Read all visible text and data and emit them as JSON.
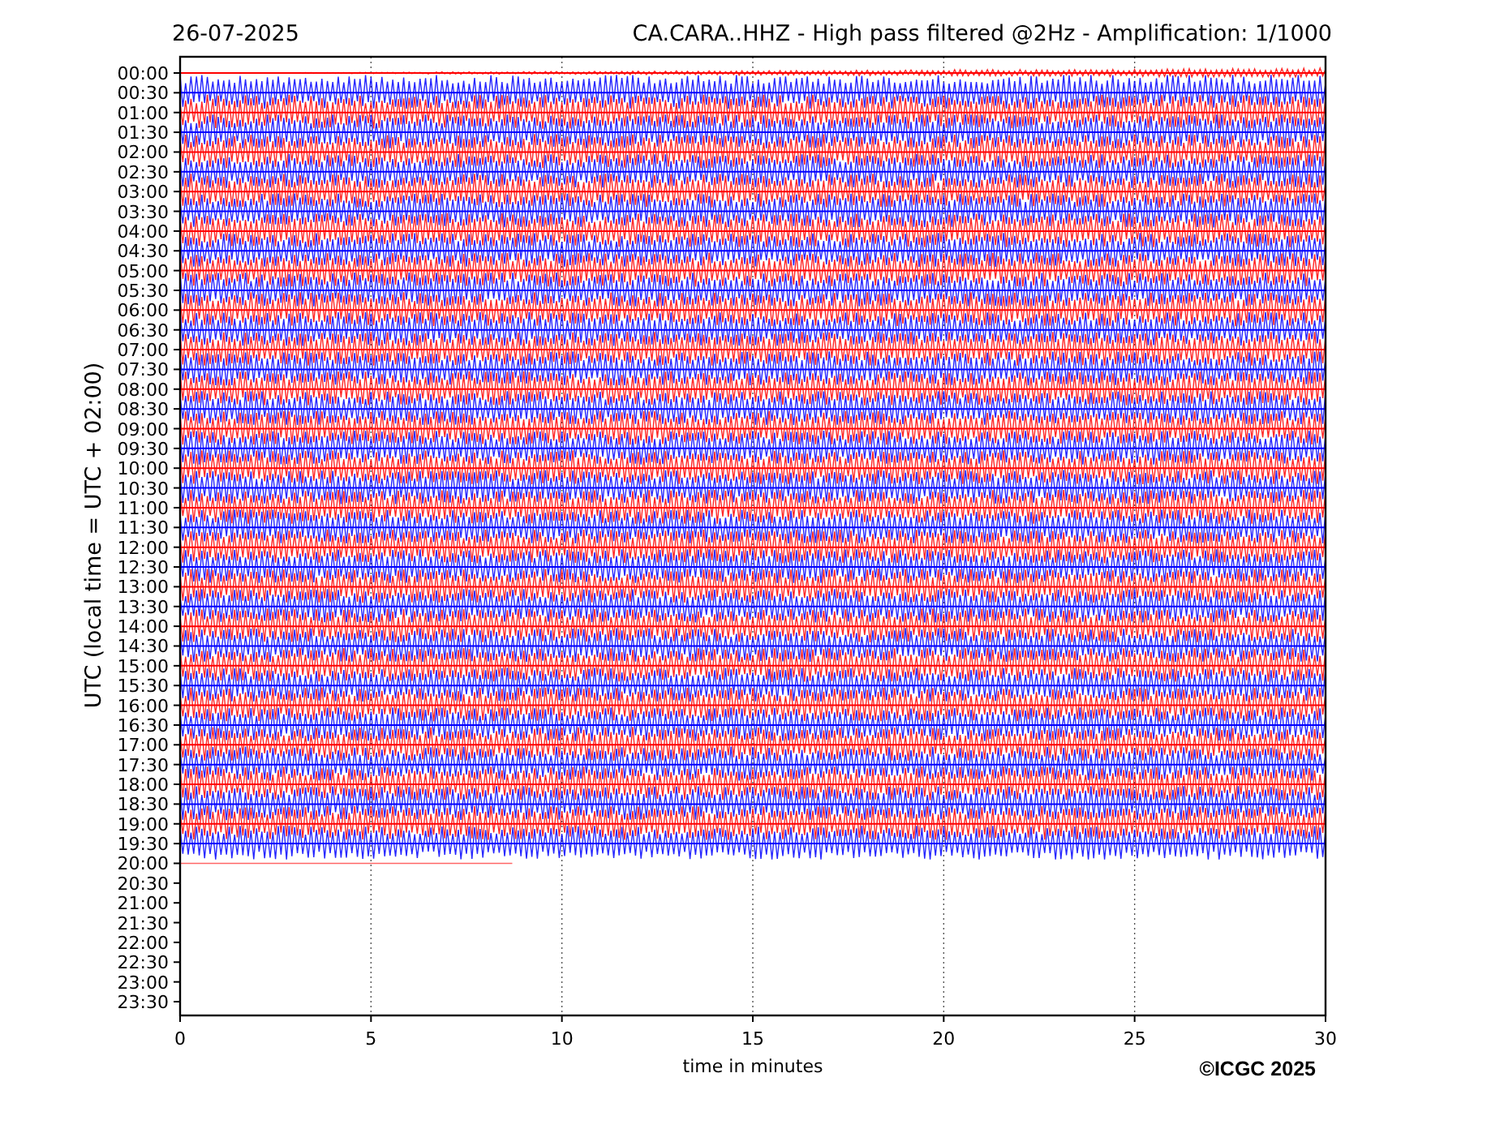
{
  "header": {
    "date": "26-07-2025",
    "title": "CA.CARA..HHZ - High pass filtered @2Hz - Amplification: 1/1000"
  },
  "y_axis": {
    "label": "UTC (local time = UTC + 02:00)",
    "ticks": [
      "00:00",
      "00:30",
      "01:00",
      "01:30",
      "02:00",
      "02:30",
      "03:00",
      "03:30",
      "04:00",
      "04:30",
      "05:00",
      "05:30",
      "06:00",
      "06:30",
      "07:00",
      "07:30",
      "08:00",
      "08:30",
      "09:00",
      "09:30",
      "10:00",
      "10:30",
      "11:00",
      "11:30",
      "12:00",
      "12:30",
      "13:00",
      "13:30",
      "14:00",
      "14:30",
      "15:00",
      "15:30",
      "16:00",
      "16:30",
      "17:00",
      "17:30",
      "18:00",
      "18:30",
      "19:00",
      "19:30",
      "20:00",
      "20:30",
      "21:00",
      "21:30",
      "22:00",
      "22:30",
      "23:00",
      "23:30"
    ]
  },
  "x_axis": {
    "label": "time in minutes",
    "ticks": [
      "0",
      "5",
      "10",
      "15",
      "20",
      "25",
      "30"
    ]
  },
  "copyright": "©ICGC 2025"
}
